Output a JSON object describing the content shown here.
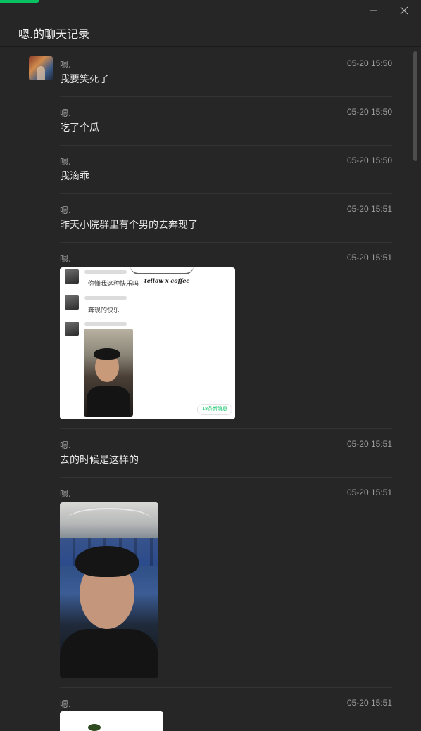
{
  "window": {
    "title": "嗯.的聊天记录",
    "accent_color": "#07c160",
    "controls": {
      "minimize_icon": "minimize-icon",
      "close_icon": "close-icon"
    }
  },
  "messages": [
    {
      "sender": "嗯.",
      "time": "05-20 15:50",
      "type": "text",
      "text": "我要笑死了",
      "show_avatar": true
    },
    {
      "sender": "嗯.",
      "time": "05-20 15:50",
      "type": "text",
      "text": "吃了个瓜"
    },
    {
      "sender": "嗯.",
      "time": "05-20 15:50",
      "type": "text",
      "text": "我滴乖"
    },
    {
      "sender": "嗯.",
      "time": "05-20 15:51",
      "type": "text",
      "text": "昨天小院群里有个男的去奔现了"
    },
    {
      "sender": "嗯.",
      "time": "05-20 15:51",
      "type": "image",
      "image": {
        "kind": "chat-screenshot",
        "lines": [
          "你懂我这种快乐吗",
          "奔现的快乐"
        ],
        "handwriting": "tellow x coffee",
        "new_messages_badge": "18条新消息"
      }
    },
    {
      "sender": "嗯.",
      "time": "05-20 15:51",
      "type": "text",
      "text": "去的时候是这样的"
    },
    {
      "sender": "嗯.",
      "time": "05-20 15:51",
      "type": "image",
      "image": {
        "kind": "selfie-photo"
      }
    },
    {
      "sender": "嗯.",
      "time": "05-20 15:51",
      "type": "image",
      "image": {
        "kind": "photo-partial"
      }
    }
  ]
}
